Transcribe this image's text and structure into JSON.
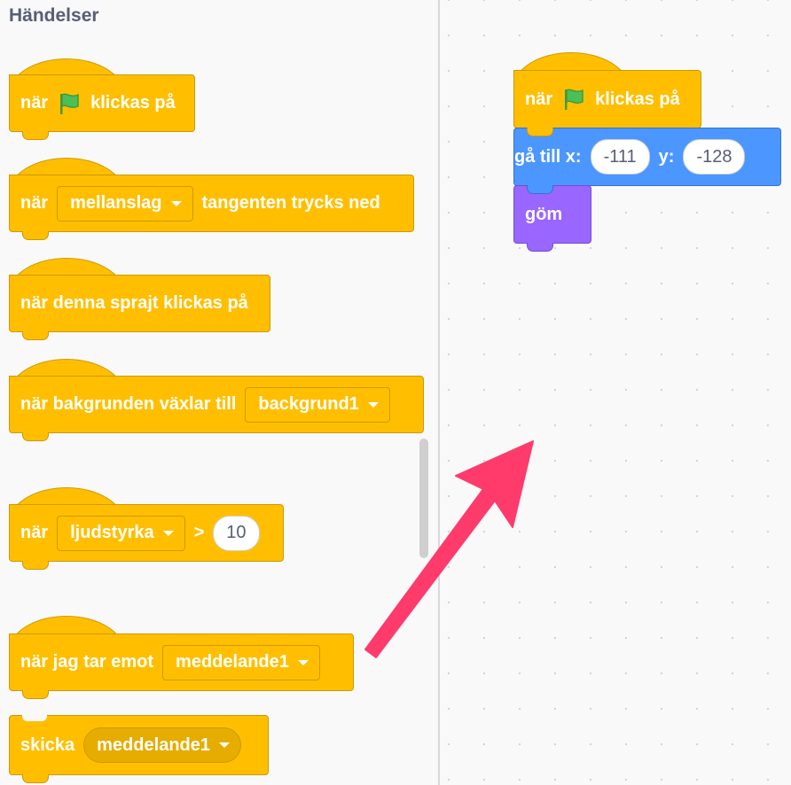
{
  "palette": {
    "category_title": "Händelser",
    "when_flag": {
      "pre": "när",
      "post": "klickas på"
    },
    "when_key": {
      "pre": "när",
      "key": "mellanslag",
      "post": "tangenten trycks ned"
    },
    "when_sprite_clicked": {
      "label": "när denna sprajt klickas på"
    },
    "when_backdrop": {
      "pre": "när bakgrunden växlar till",
      "value": "backgrund1"
    },
    "when_greater": {
      "pre": "när",
      "param": "ljudstyrka",
      "op": ">",
      "value": "10"
    },
    "when_receive": {
      "pre": "när jag tar emot",
      "message": "meddelande1"
    },
    "broadcast": {
      "pre": "skicka",
      "message": "meddelande1"
    }
  },
  "workspace": {
    "script": {
      "hat": {
        "pre": "när",
        "post": "klickas på"
      },
      "goto": {
        "label": "gå till x:",
        "x_label": "y:",
        "x": "-111",
        "y": "-128"
      },
      "hide": {
        "label": "göm"
      }
    }
  },
  "colors": {
    "events": "#ffbf00",
    "motion": "#4c97ff",
    "looks": "#9966ff",
    "arrow": "#ff3b6b",
    "flag": "#4cbf56"
  },
  "icons": [
    "green-flag-icon",
    "dropdown-arrow-icon"
  ]
}
